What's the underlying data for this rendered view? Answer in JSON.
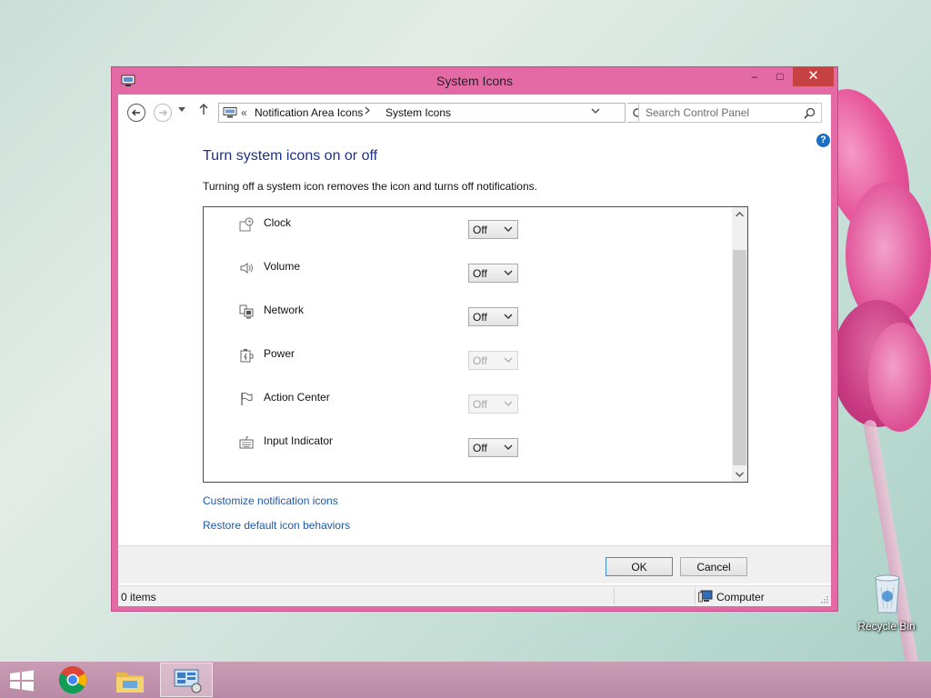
{
  "window": {
    "title": "System Icons",
    "controls": {
      "minimize": "–",
      "maximize": "□",
      "close": "✕"
    }
  },
  "nav": {
    "breadcrumb": [
      "Notification Area Icons",
      "System Icons"
    ],
    "overflow": "«",
    "search_placeholder": "Search Control Panel"
  },
  "help_label": "?",
  "content": {
    "heading": "Turn system icons on or off",
    "description": "Turning off a system icon removes the icon and turns off notifications."
  },
  "system_icons": [
    {
      "name": "Clock",
      "icon": "clock-icon",
      "value": "Off",
      "enabled": true
    },
    {
      "name": "Volume",
      "icon": "volume-icon",
      "value": "Off",
      "enabled": true
    },
    {
      "name": "Network",
      "icon": "network-icon",
      "value": "Off",
      "enabled": true
    },
    {
      "name": "Power",
      "icon": "power-icon",
      "value": "Off",
      "enabled": false
    },
    {
      "name": "Action Center",
      "icon": "flag-icon",
      "value": "Off",
      "enabled": false
    },
    {
      "name": "Input Indicator",
      "icon": "keyboard-icon",
      "value": "Off",
      "enabled": true
    }
  ],
  "links": {
    "customize": "Customize notification icons",
    "restore": "Restore default icon behaviors"
  },
  "buttons": {
    "ok": "OK",
    "cancel": "Cancel"
  },
  "status": {
    "items": "0 items",
    "location": "Computer"
  },
  "desktop": {
    "recycle_bin": "Recycle Bin"
  },
  "colors": {
    "window_frame": "#e46aa6",
    "close_button": "#c74242",
    "heading": "#1e3287",
    "link": "#1c5aa9",
    "help": "#1b6fc2"
  }
}
